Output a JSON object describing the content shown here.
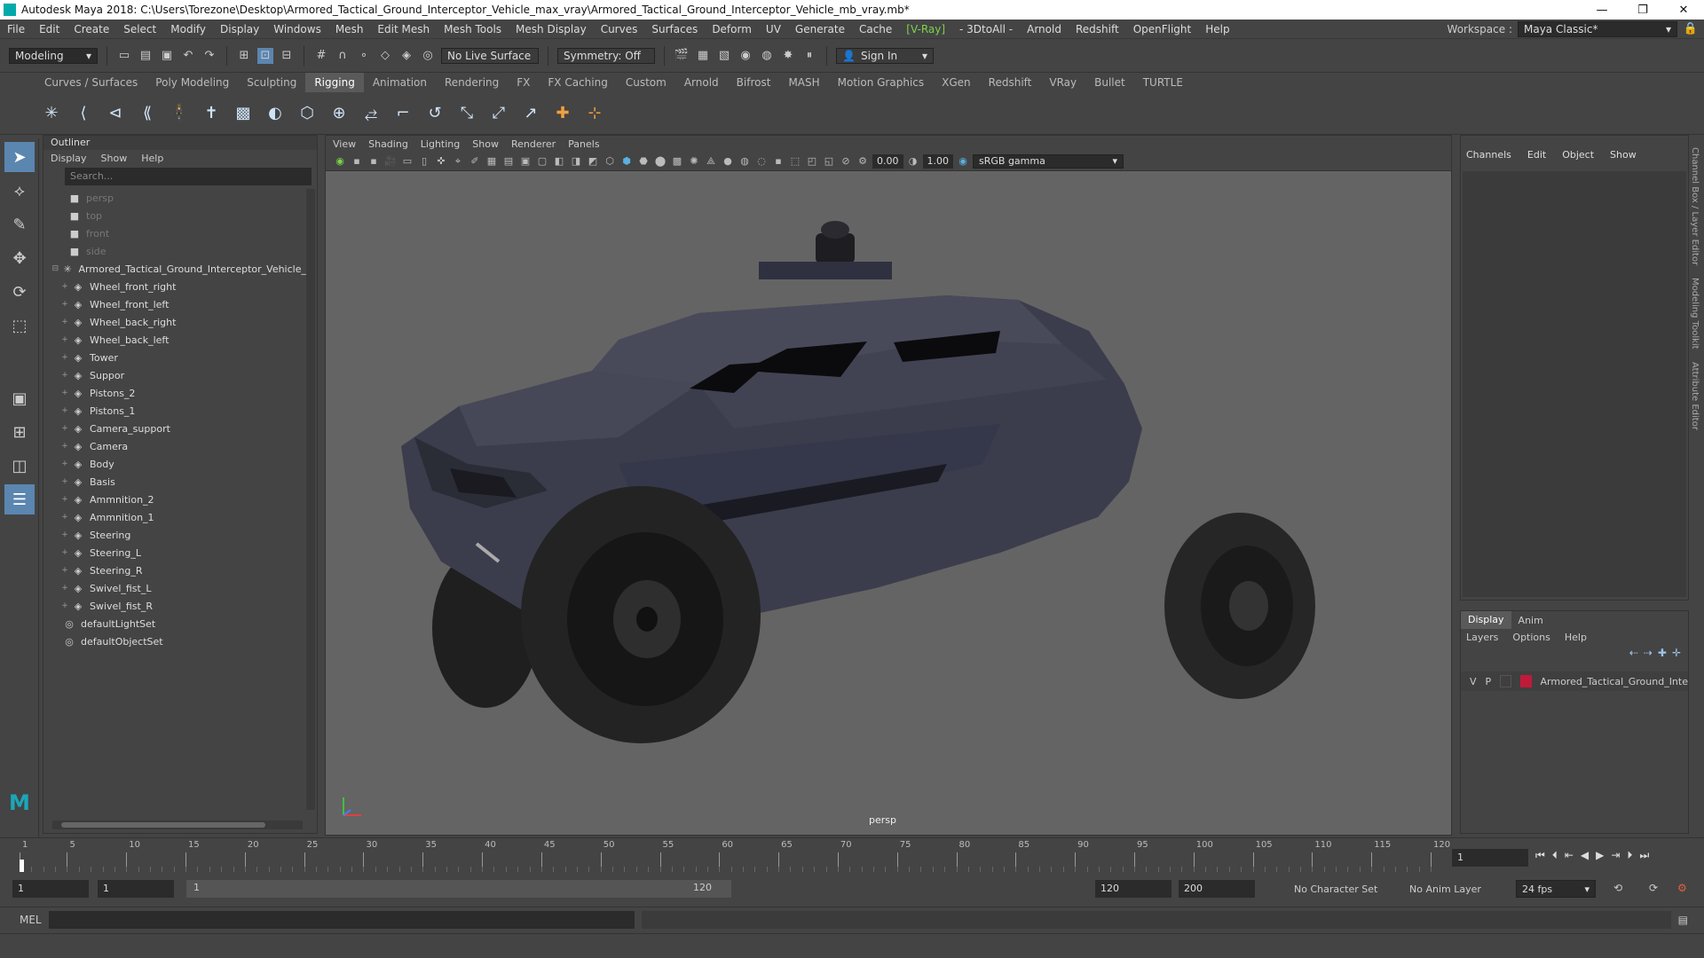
{
  "titlebar": {
    "title": "Autodesk Maya 2018: C:\\Users\\Torezone\\Desktop\\Armored_Tactical_Ground_Interceptor_Vehicle_max_vray\\Armored_Tactical_Ground_Interceptor_Vehicle_mb_vray.mb*",
    "minimize": "—",
    "restore": "❐",
    "close": "✕"
  },
  "menubar": {
    "items": [
      "File",
      "Edit",
      "Create",
      "Select",
      "Modify",
      "Display",
      "Windows",
      "Mesh",
      "Edit Mesh",
      "Mesh Tools",
      "Mesh Display",
      "Curves",
      "Surfaces",
      "Deform",
      "UV",
      "Generate",
      "Cache",
      "[V-Ray]",
      "- 3DtoAll -",
      "Arnold",
      "Redshift",
      "OpenFlight",
      "Help"
    ],
    "workspace_label": "Workspace :",
    "workspace_value": "Maya Classic*"
  },
  "statusline": {
    "mode": "Modeling",
    "live_surface": "No Live Surface",
    "symmetry": "Symmetry: Off",
    "sign_in": "Sign In"
  },
  "shelf": {
    "tabs": [
      "Curves / Surfaces",
      "Poly Modeling",
      "Sculpting",
      "Rigging",
      "Animation",
      "Rendering",
      "FX",
      "FX Caching",
      "Custom",
      "Arnold",
      "Bifrost",
      "MASH",
      "Motion Graphics",
      "XGen",
      "Redshift",
      "VRay",
      "Bullet",
      "TURTLE"
    ],
    "active_tab": "Rigging"
  },
  "outliner": {
    "title": "Outliner",
    "menu": [
      "Display",
      "Show",
      "Help"
    ],
    "search_placeholder": "Search...",
    "cameras": [
      "persp",
      "top",
      "front",
      "side"
    ],
    "root": "Armored_Tactical_Ground_Interceptor_Vehicle_",
    "children": [
      "Wheel_front_right",
      "Wheel_front_left",
      "Wheel_back_right",
      "Wheel_back_left",
      "Tower",
      "Suppor",
      "Pistons_2",
      "Pistons_1",
      "Camera_support",
      "Camera",
      "Body",
      "Basis",
      "Ammnition_2",
      "Ammnition_1",
      "Steering",
      "Steering_L",
      "Steering_R",
      "Swivel_fist_L",
      "Swivel_fist_R"
    ],
    "sets": [
      "defaultLightSet",
      "defaultObjectSet"
    ]
  },
  "viewport": {
    "menu": [
      "View",
      "Shading",
      "Lighting",
      "Show",
      "Renderer",
      "Panels"
    ],
    "near_value": "0.00",
    "far_value": "1.00",
    "color_space": "sRGB gamma",
    "camera_label": "persp"
  },
  "channelbox": {
    "menu": [
      "Channels",
      "Edit",
      "Object",
      "Show"
    ]
  },
  "layereditor": {
    "tabs": [
      "Display",
      "Anim"
    ],
    "active_tab": "Display",
    "menu": [
      "Layers",
      "Options",
      "Help"
    ],
    "layer": {
      "v": "V",
      "p": "P",
      "name": "Armored_Tactical_Ground_Inte",
      "color": "#c01a3a"
    }
  },
  "sidetabs": [
    "Channel Box / Layer Editor",
    "Modeling Toolkit",
    "Attribute Editor"
  ],
  "timeline": {
    "ticks": [
      "1",
      "5",
      "10",
      "15",
      "20",
      "25",
      "30",
      "35",
      "40",
      "45",
      "50",
      "55",
      "60",
      "65",
      "70",
      "75",
      "80",
      "85",
      "90",
      "95",
      "100",
      "105",
      "110",
      "115",
      "120"
    ],
    "current_frame": "1"
  },
  "range": {
    "start": "1",
    "anim_start": "1",
    "range_start_label": "1",
    "range_end_label": "120",
    "end": "120",
    "anim_end": "200",
    "character_set": "No Character Set",
    "anim_layer": "No Anim Layer",
    "fps": "24 fps"
  },
  "cmdline": {
    "label": "MEL"
  }
}
